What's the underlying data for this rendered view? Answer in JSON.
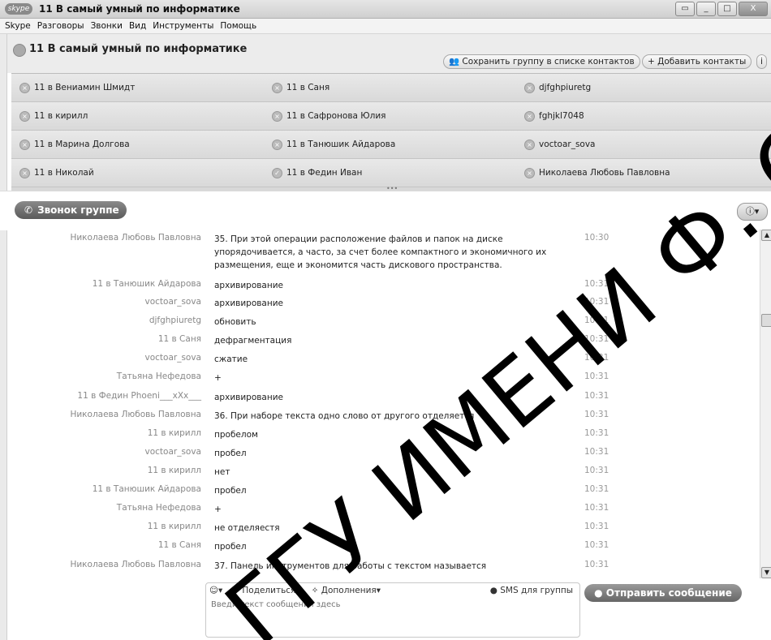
{
  "window": {
    "app_logo": "skype",
    "title": "11 В самый умный по информатике"
  },
  "menu": [
    "Skype",
    "Разговоры",
    "Звонки",
    "Вид",
    "Инструменты",
    "Помощь"
  ],
  "conversation": {
    "title": "11 В самый умный по информатике",
    "save_group_label": "Сохранить группу в списке контактов",
    "add_contacts_label": "+ Добавить контакты",
    "info_label": "i"
  },
  "participants": [
    "11 в Вениамин Шмидт",
    "11 в Саня",
    "djfghpiuretg",
    "11 в кирилл",
    "11 в Сафронова Юлия",
    "fghjkl7048",
    "11 в Марина Долгова",
    "11 в Танюшик Айдарова",
    "voctoar_sova",
    "11 в Николай",
    "11 в Федин Иван",
    "Николаева Любовь Павловна"
  ],
  "call_button_label": "Звонок группе",
  "messages": [
    {
      "sender": "Николаева Любовь Павловна",
      "text": "35. При этой операции расположение файлов и папок на диске упорядочивается, а часто, за счет более компактного и экономичного их размещения, еще и экономится часть дискового пространства.",
      "time": "10:30"
    },
    {
      "sender": "11 в Танюшик Айдарова",
      "text": "архивирование",
      "time": "10:31"
    },
    {
      "sender": "voctoar_sova",
      "text": "архивирование",
      "time": "10:31"
    },
    {
      "sender": "djfghpiuretg",
      "text": "обновить",
      "time": "10:31"
    },
    {
      "sender": "11 в Саня",
      "text": "дефрагментация",
      "time": "10:31"
    },
    {
      "sender": "voctoar_sova",
      "text": "сжатие",
      "time": "10:31"
    },
    {
      "sender": "Татьяна Нефедова",
      "text": "+",
      "time": "10:31"
    },
    {
      "sender": "11 в Федин Phoeni___xXx___",
      "text": "архивирование",
      "time": "10:31"
    },
    {
      "sender": "Николаева Любовь Павловна",
      "text": "36. При наборе текста одно слово от другого отделяется",
      "time": "10:31"
    },
    {
      "sender": "11 в кирилл",
      "text": "пробелом",
      "time": "10:31"
    },
    {
      "sender": "voctoar_sova",
      "text": "пробел",
      "time": "10:31"
    },
    {
      "sender": "11 в кирилл",
      "text": "нет",
      "time": "10:31"
    },
    {
      "sender": "11 в Танюшик Айдарова",
      "text": "пробел",
      "time": "10:31"
    },
    {
      "sender": "Татьяна Нефедова",
      "text": "+",
      "time": "10:31"
    },
    {
      "sender": "11 в кирилл",
      "text": "не отделяестя",
      "time": "10:31"
    },
    {
      "sender": "11 в Саня",
      "text": "пробел",
      "time": "10:31"
    },
    {
      "sender": "Николаева Любовь Павловна",
      "text": "37. Панель инструментов для работы с текстом называется",
      "time": "10:31"
    }
  ],
  "composer": {
    "emoji_label": "☺▾",
    "share_label": "Поделиться▾",
    "extras_label": "Дополнения▾",
    "sms_label": "SMS для группы",
    "placeholder": "Введи текст сообщения здесь"
  },
  "send_button_label": "Отправить сообщение",
  "watermark_text": "ГГУ ИМЕНИ Ф. СК"
}
